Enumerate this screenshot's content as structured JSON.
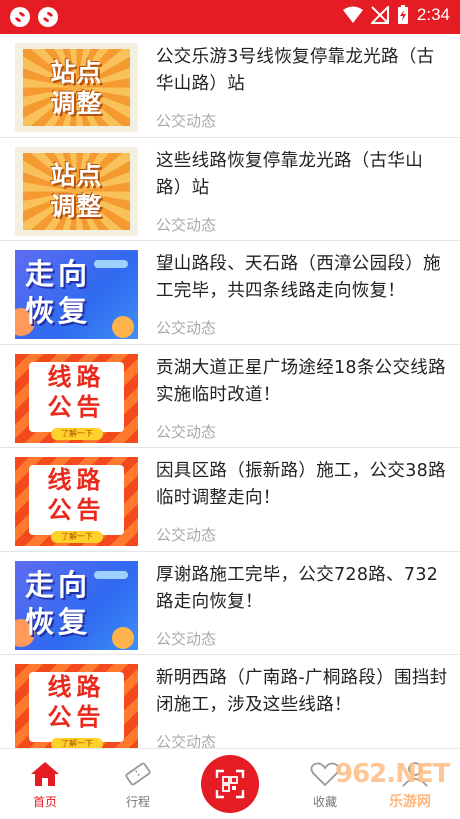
{
  "status_bar": {
    "time": "2:34"
  },
  "news": [
    {
      "title": "公交乐游3号线恢复停靠龙光路（古华山路）站",
      "tag": "公交动态",
      "thumb": {
        "style": "orange",
        "line1": "站点",
        "line2": "调整"
      }
    },
    {
      "title": "这些线路恢复停靠龙光路（古华山路）站",
      "tag": "公交动态",
      "thumb": {
        "style": "orange",
        "line1": "站点",
        "line2": "调整"
      }
    },
    {
      "title": "望山路段、天石路（西漳公园段）施工完毕，共四条线路走向恢复！",
      "tag": "公交动态",
      "thumb": {
        "style": "blue",
        "line1": "走向",
        "line2": "恢复"
      }
    },
    {
      "title": "贡湖大道正星广场途经18条公交线路实施临时改道！",
      "tag": "公交动态",
      "thumb": {
        "style": "red",
        "line1": "线路",
        "line2": "公告",
        "pill": "了解一下"
      }
    },
    {
      "title": "因具区路（振新路）施工，公交38路临时调整走向！",
      "tag": "公交动态",
      "thumb": {
        "style": "red",
        "line1": "线路",
        "line2": "公告",
        "pill": "了解一下"
      }
    },
    {
      "title": "厚谢路施工完毕，公交728路、732路走向恢复！",
      "tag": "公交动态",
      "thumb": {
        "style": "blue",
        "line1": "走向",
        "line2": "恢复"
      }
    },
    {
      "title": "新明西路（广南路-广桐路段）围挡封闭施工，涉及这些线路！",
      "tag": "公交动态",
      "thumb": {
        "style": "red",
        "line1": "线路",
        "line2": "公告",
        "pill": "了解一下"
      }
    }
  ],
  "bottom_nav": {
    "home": "首页",
    "trips": "行程",
    "favorites": "收藏",
    "watermark": "962.NET",
    "watermark_sub": "乐游网"
  },
  "colors": {
    "accent": "#e51c23"
  }
}
